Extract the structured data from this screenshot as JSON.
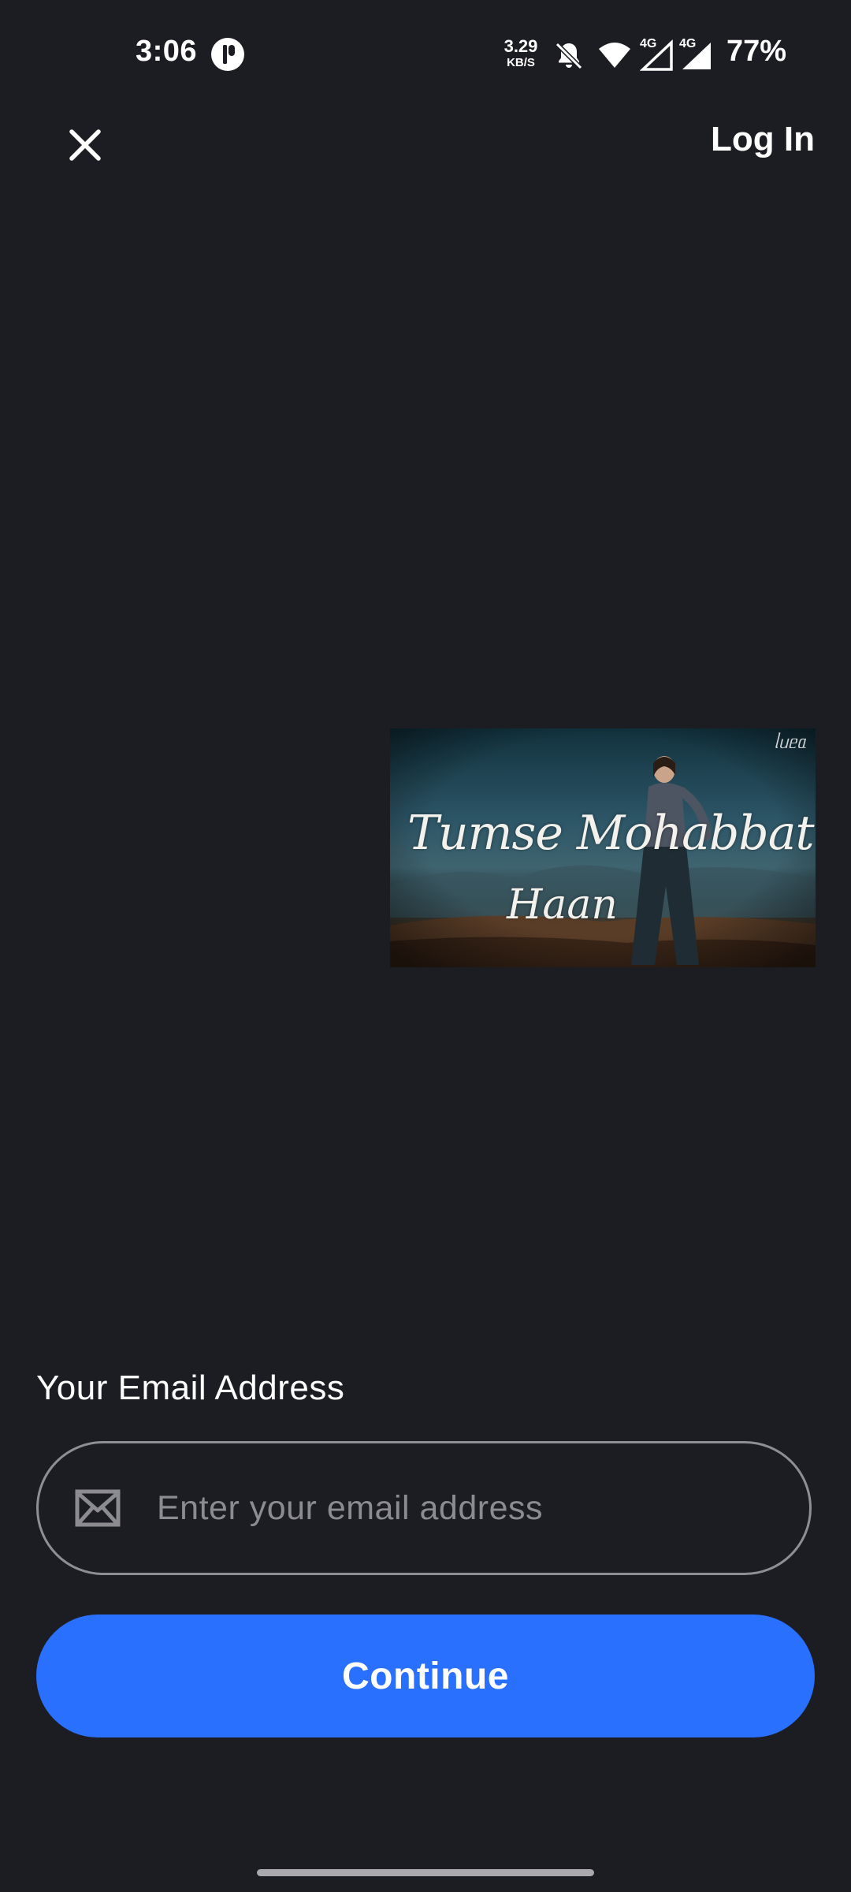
{
  "status_bar": {
    "time": "3:06",
    "speed_value": "3.29",
    "speed_unit": "KB/S",
    "network_1": "4G",
    "network_2": "4G",
    "battery": "77%",
    "icons": [
      "app-notification-icon",
      "bell-off-icon",
      "wifi-icon",
      "signal-icon",
      "signal-icon",
      "battery-text"
    ]
  },
  "header": {
    "close_icon": "close-icon",
    "login_label": "Log In"
  },
  "video": {
    "caption_line_1": "Tumse Mohabbat Hai",
    "caption_line_2": "Haan",
    "watermark": "ᥣᥙᥱᥲ"
  },
  "form": {
    "email_label": "Your Email Address",
    "email_placeholder": "Enter your email address",
    "email_value": "",
    "mail_icon": "mail-icon",
    "continue_label": "Continue"
  },
  "colors": {
    "background": "#1c1c23",
    "accent": "#2970ff",
    "field_border": "#8e8e93",
    "placeholder": "#8b8b90"
  }
}
